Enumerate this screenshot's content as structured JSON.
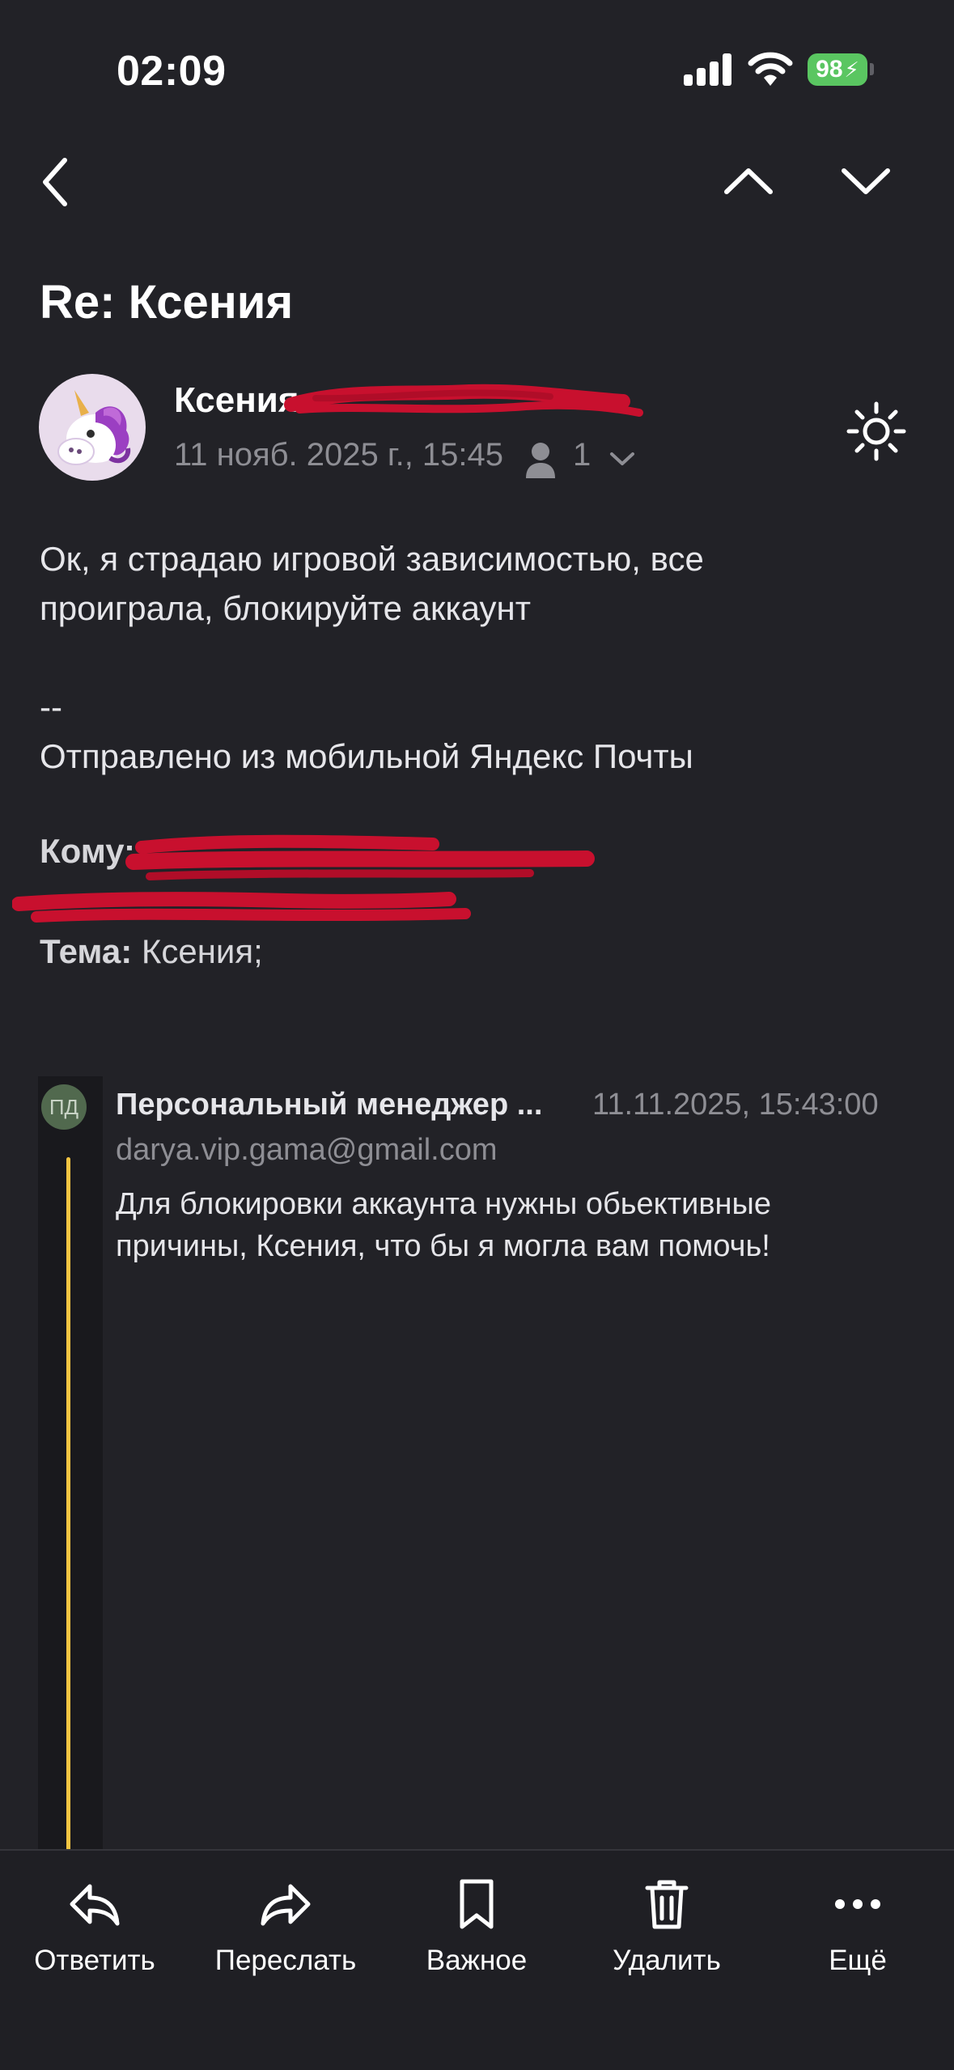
{
  "status_bar": {
    "time": "02:09",
    "battery": "98"
  },
  "message": {
    "subject": "Re: Ксения",
    "sender_name": "Ксения",
    "date": "11 нояб. 2025 г., 15:45",
    "recipients_count": "1",
    "body_line1": "Ок, я страдаю игровой зависимостью, все",
    "body_line2": "проиграла, блокируйте аккаунт",
    "signature_sep": "--",
    "signature": "Отправлено из мобильной Яндекс Почты",
    "to_label": "Кому:",
    "theme_label": "Тема:",
    "theme_value": "Ксения;"
  },
  "quoted": {
    "initials": "ПД",
    "sender": "Персональный менеджер ...",
    "date": "11.11.2025, 15:43:00",
    "email": "darya.vip.gama@gmail.com",
    "body_line1": "Для блокировки аккаунта нужны обьективные",
    "body_line2": "причины, Ксения, что бы  я могла вам помочь!"
  },
  "toolbar": {
    "reply": "Ответить",
    "forward": "Переслать",
    "important": "Важное",
    "delete": "Удалить",
    "more": "Ещё"
  },
  "colors": {
    "background": "#222227",
    "accent_quote": "#f5c542",
    "battery": "#5ac661",
    "redaction": "#c8102e"
  },
  "icons": [
    "back-icon",
    "chevron-up-icon",
    "chevron-down-icon",
    "sun-icon",
    "person-icon",
    "reply-icon",
    "forward-icon",
    "bookmark-icon",
    "trash-icon",
    "more-icon"
  ]
}
